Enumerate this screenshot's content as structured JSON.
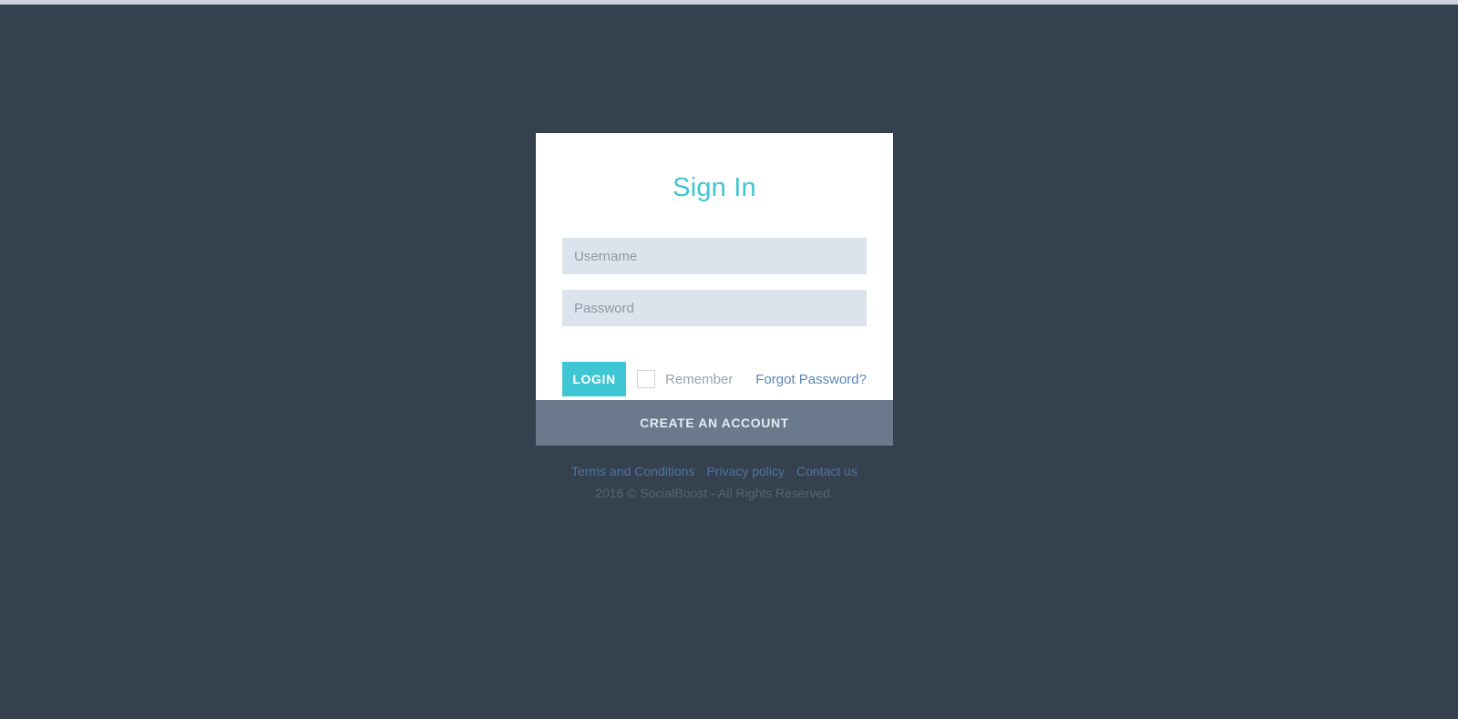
{
  "card": {
    "title": "Sign In",
    "username": {
      "placeholder": "Username",
      "value": ""
    },
    "password": {
      "placeholder": "Password",
      "value": ""
    },
    "login_label": "LOGIN",
    "remember_label": "Remember",
    "remember_checked": false,
    "forgot_label": "Forgot Password?"
  },
  "create_account_label": "CREATE AN ACCOUNT",
  "footer": {
    "links": [
      {
        "label": "Terms and Conditions"
      },
      {
        "label": "Privacy policy"
      },
      {
        "label": "Contact us"
      }
    ],
    "copyright": "2016 © SocialBoost - All Rights Reserved."
  },
  "colors": {
    "page_background": "#36414f",
    "accent": "#3ec6d4",
    "title": "#40c5d2",
    "input_background": "#dde3ec",
    "create_account_background": "#6b798d",
    "link": "#5b87b8",
    "footer_link": "#4d749f",
    "copyright": "#566474"
  }
}
